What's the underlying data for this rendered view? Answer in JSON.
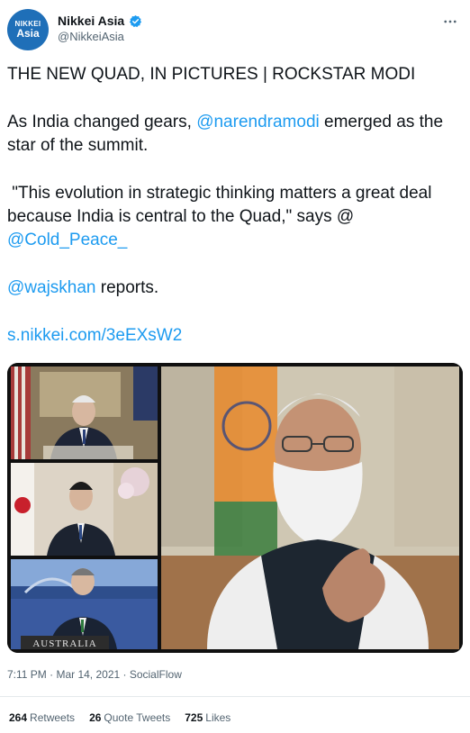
{
  "account": {
    "avatar_line1": "NIKKEI",
    "avatar_line2": "Asia",
    "display_name": "Nikkei Asia",
    "handle": "@NikkeiAsia",
    "verified": true
  },
  "tweet": {
    "headline": "THE NEW QUAD, IN PICTURES | ROCKSTAR MODI",
    "p2_before": "As India changed gears, ",
    "p2_mention": "@narendramodi",
    "p2_after": " emerged as the star of the summit.",
    "p3_text": " \"This evolution in strategic thinking matters a great deal because India is central to the Quad,\" says @ ",
    "p3_mention": "@Cold_Peace_",
    "p4_mention": "@wajskhan",
    "p4_after": " reports.",
    "link": "s.nikkei.com/3eEXsW2"
  },
  "media": {
    "caption_label": "AUSTRALIA"
  },
  "meta": {
    "timestamp": "7:11 PM · Mar 14, 2021 · SocialFlow"
  },
  "stats": {
    "retweets_count": "264",
    "retweets_label": "Retweets",
    "quotes_count": "26",
    "quotes_label": "Quote Tweets",
    "likes_count": "725",
    "likes_label": "Likes"
  },
  "colors": {
    "link": "#1d9bf0",
    "verified": "#1d9bf0",
    "avatar": "#1f6fb8"
  },
  "icons": {
    "verified": "verified-badge-icon",
    "more": "more-options-icon"
  }
}
